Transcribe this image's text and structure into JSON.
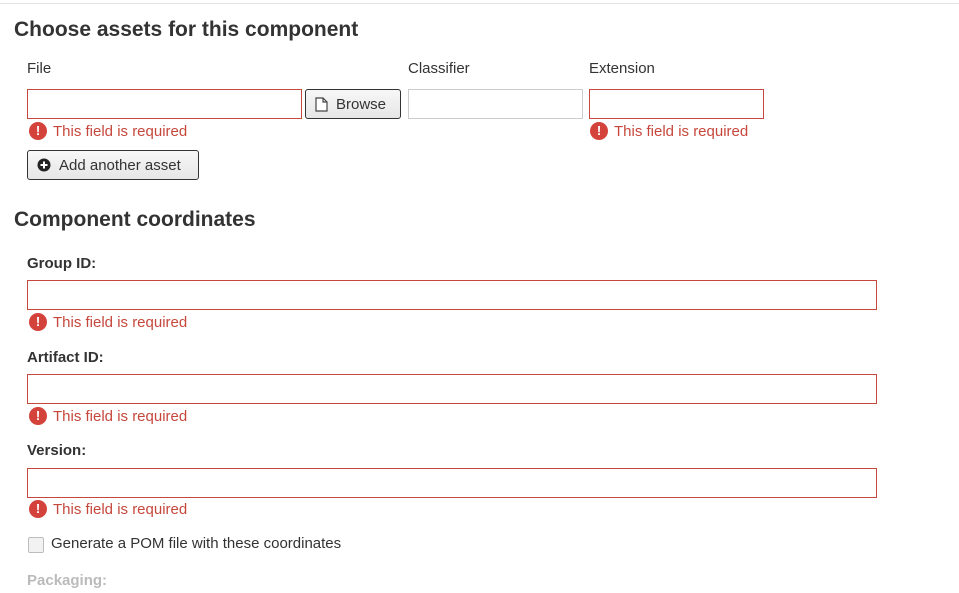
{
  "assets_section": {
    "title": "Choose assets for this component",
    "columns": {
      "file": "File",
      "classifier": "Classifier",
      "extension": "Extension"
    },
    "file_value": "",
    "classifier_value": "",
    "extension_value": "",
    "browse_label": "Browse",
    "file_error": "This field is required",
    "extension_error": "This field is required",
    "add_asset_label": "Add another asset"
  },
  "coordinates_section": {
    "title": "Component coordinates",
    "group_id": {
      "label": "Group ID:",
      "value": "",
      "error": "This field is required"
    },
    "artifact_id": {
      "label": "Artifact ID:",
      "value": "",
      "error": "This field is required"
    },
    "version": {
      "label": "Version:",
      "value": "",
      "error": "This field is required"
    },
    "generate_pom": {
      "label": "Generate a POM file with these coordinates",
      "checked": false
    },
    "packaging": {
      "label": "Packaging:"
    }
  },
  "colors": {
    "error": "#c6473c",
    "error_icon": "#d4433b",
    "disabled_text": "#bbbbbb"
  },
  "icons": {
    "error": "exclamation-circle-icon",
    "browse": "file-icon",
    "add": "plus-circle-icon"
  }
}
